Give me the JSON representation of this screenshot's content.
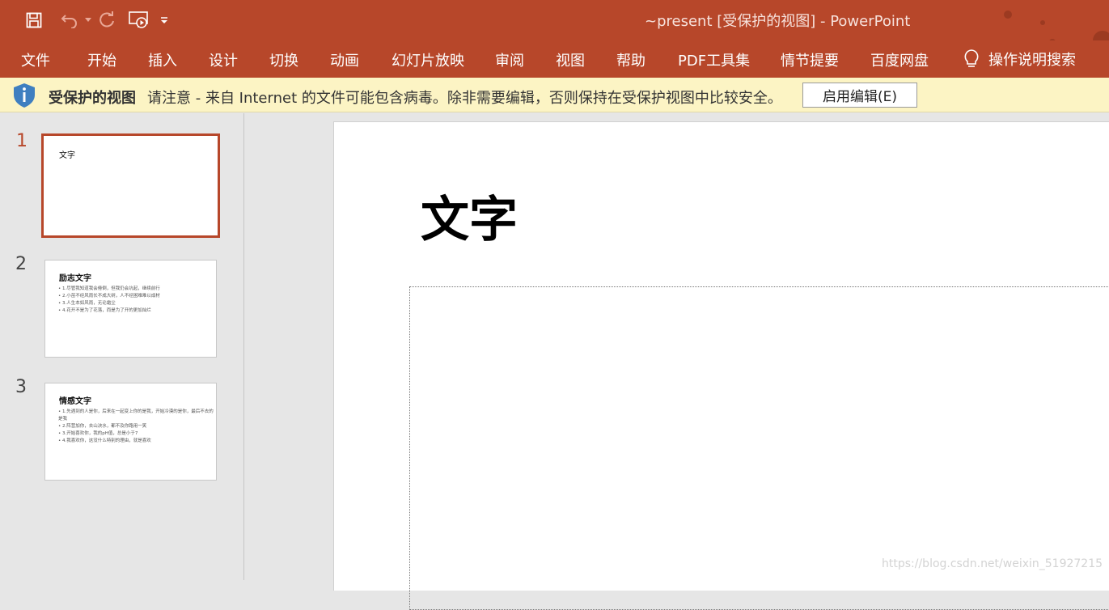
{
  "window": {
    "title": "~present [受保护的视图]  -  PowerPoint"
  },
  "quick_access": {
    "save_icon": "save-icon",
    "undo_icon": "undo-icon",
    "redo_icon": "redo-icon",
    "slideshow_icon": "slideshow-from-start-icon",
    "customize_icon": "customize-qat-icon"
  },
  "ribbon": {
    "tabs": [
      "文件",
      "开始",
      "插入",
      "设计",
      "切换",
      "动画",
      "幻灯片放映",
      "审阅",
      "视图",
      "帮助",
      "PDF工具集",
      "情节提要",
      "百度网盘"
    ],
    "tell_me": "操作说明搜索"
  },
  "protected_bar": {
    "title": "受保护的视图",
    "message": "请注意 - 来自 Internet 的文件可能包含病毒。除非需要编辑，否则保持在受保护视图中比较安全。",
    "button": "启用编辑(E)"
  },
  "thumbnails": [
    {
      "number": "1",
      "title": "文字",
      "bullets": []
    },
    {
      "number": "2",
      "title": "励志文字",
      "bullets": [
        "• 1.尽管我知道我会倦倒，但我仍会坑起，继续前行",
        "• 2.小苗不经风雨长不成大树，人不经困难难以成材",
        "• 3.人生本如风雨，无论霜尘",
        "• 4.花开不是为了花落，而是为了开的更加灿烂"
      ]
    },
    {
      "number": "3",
      "title": "情感文字",
      "bullets": [
        "• 1.先遇到的人是你，后来在一起变上你的是我，开始冷漠的是你，最后不去的是我",
        "• 2.阵营加你，去山决水，都不及你路用一笑",
        "• 3.开始喜欢你，我的pH值，总是小于7",
        "• 4.我喜欢你，这没什么特别的理由，就是喜欢"
      ]
    }
  ],
  "slide": {
    "title": "文字"
  },
  "watermark": "https://blog.csdn.net/weixin_51927215",
  "colors": {
    "accent": "#b7472a",
    "message_bar": "#fcf4c4",
    "shield": "#3f7fc0"
  }
}
